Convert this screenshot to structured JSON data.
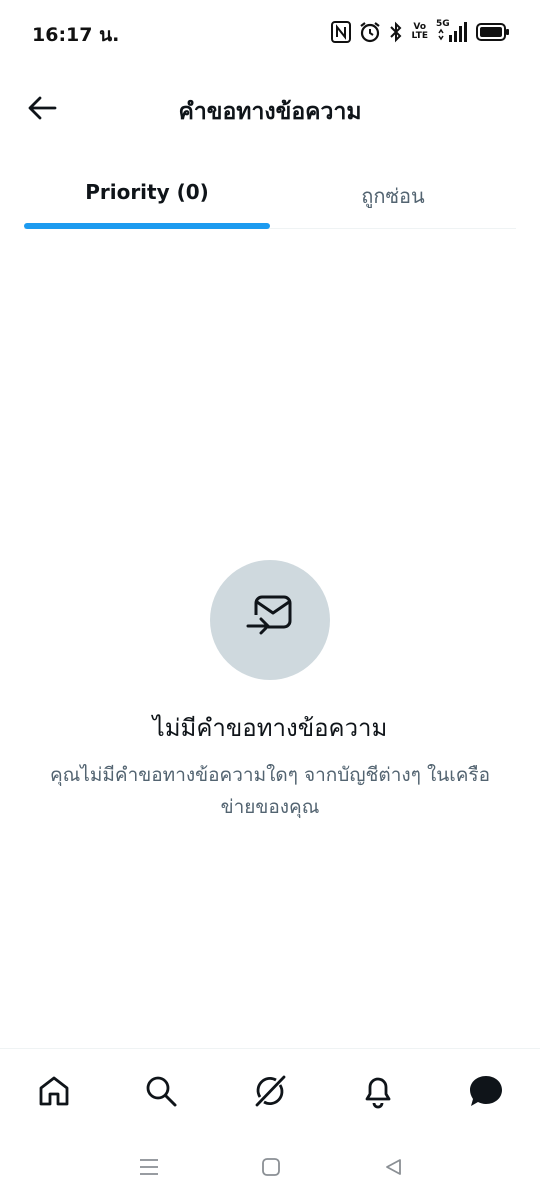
{
  "status_bar": {
    "time": "16:17 น.",
    "volte_top": "Vo",
    "volte_bottom": "LTE",
    "network": "5G",
    "icons": [
      "nfc-icon",
      "alarm-icon",
      "bluetooth-icon",
      "volte-icon",
      "signal-icon",
      "battery-icon"
    ]
  },
  "header": {
    "title": "คำขอทางข้อความ",
    "back_icon": "arrow-left-icon"
  },
  "tabs": [
    {
      "label": "Priority (0)",
      "active": true
    },
    {
      "label": "ถูกซ่อน",
      "active": false
    }
  ],
  "empty_state": {
    "icon": "envelope-arrow-icon",
    "title": "ไม่มีคำขอทางข้อความ",
    "description": "คุณไม่มีคำขอทางข้อความใดๆ จากบัญชีต่างๆ ในเครือข่ายของคุณ"
  },
  "bottom_nav": {
    "items": [
      "home-icon",
      "search-icon",
      "grok-icon",
      "notifications-icon",
      "messages-icon"
    ]
  },
  "system_nav": {
    "items": [
      "menu-icon",
      "home-square-icon",
      "back-triangle-icon"
    ]
  },
  "colors": {
    "accent": "#1d9bf0",
    "text_primary": "#0f1419",
    "text_secondary": "#536471",
    "icon_circle": "#cfd9de"
  }
}
